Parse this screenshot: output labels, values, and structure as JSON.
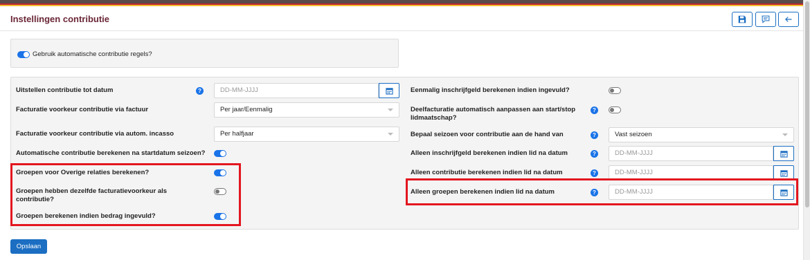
{
  "header": {
    "title": "Instellingen contributie",
    "buttons": [
      {
        "name": "save-icon-button",
        "icon": "floppy-disk-icon"
      },
      {
        "name": "comment-icon-button",
        "icon": "speech-bubble-icon"
      },
      {
        "name": "back-icon-button",
        "icon": "arrow-left-icon"
      }
    ]
  },
  "auto": {
    "label": "Gebruik automatische contributie regels?",
    "enabled": true
  },
  "left": {
    "uitstellen": {
      "label": "Uitstellen contributie tot datum",
      "placeholder": "DD-MM-JJJJ"
    },
    "facturatie_factuur": {
      "label": "Facturatie voorkeur contributie via factuur",
      "value": "Per jaar/Eenmalig"
    },
    "facturatie_incasso": {
      "label": "Facturatie voorkeur contributie via autom. incasso",
      "value": "Per halfjaar"
    },
    "startdatum": {
      "label": "Automatische contributie berekenen na startdatum seizoen?",
      "enabled": true
    },
    "overige_relaties": {
      "label": "Groepen voor Overige relaties berekenen?",
      "enabled": true
    },
    "zelfde_voorkeur": {
      "label": "Groepen hebben dezelfde facturatievoorkeur als contributie?",
      "enabled": false
    },
    "bedrag_ingevuld": {
      "label": "Groepen berekenen indien bedrag ingevuld?",
      "enabled": true
    }
  },
  "right": {
    "inschrijfgeld": {
      "label": "Eenmalig inschrijfgeld berekenen indien ingevuld?",
      "enabled": false
    },
    "deelfacturatie": {
      "label": "Deelfacturatie automatisch aanpassen aan start/stop lidmaatschap?",
      "enabled": false
    },
    "seizoen": {
      "label": "Bepaal seizoen voor contributie aan de hand van",
      "value": "Vast seizoen"
    },
    "alleen_inschrijfgeld": {
      "label": "Alleen inschrijfgeld berekenen indien lid na datum",
      "placeholder": "DD-MM-JJJJ"
    },
    "alleen_contributie": {
      "label": "Alleen contributie berekenen indien lid na datum",
      "placeholder": "DD-MM-JJJJ"
    },
    "alleen_groepen": {
      "label": "Alleen groepen berekenen indien lid na datum",
      "placeholder": "DD-MM-JJJJ"
    }
  },
  "help_glyph": "?",
  "footer": {
    "save_label": "Opslaan"
  },
  "colors": {
    "accent": "#1b6ec2",
    "title": "#6b2737",
    "highlight": "#e3161f"
  }
}
